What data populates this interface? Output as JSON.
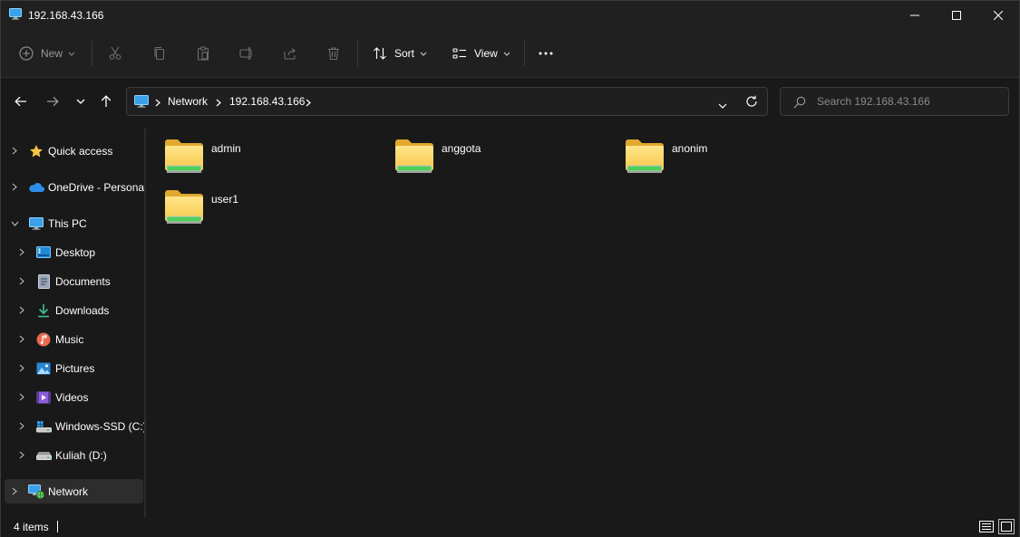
{
  "window": {
    "title": "192.168.43.166",
    "accent": "#60cdff"
  },
  "commandbar": {
    "new_label": "New",
    "sort_label": "Sort",
    "view_label": "View",
    "items": [
      {
        "name": "new-button",
        "icon": "plus-circle-icon"
      },
      {
        "name": "cut-button",
        "icon": "scissors-icon"
      },
      {
        "name": "copy-button",
        "icon": "copy-icon"
      },
      {
        "name": "paste-button",
        "icon": "paste-icon"
      },
      {
        "name": "rename-button",
        "icon": "rename-icon"
      },
      {
        "name": "share-button",
        "icon": "share-icon"
      },
      {
        "name": "delete-button",
        "icon": "trash-icon"
      },
      {
        "name": "sort-button",
        "icon": "sort-icon"
      },
      {
        "name": "view-button",
        "icon": "view-list-icon"
      },
      {
        "name": "more-button",
        "icon": "ellipsis-icon"
      }
    ]
  },
  "address": {
    "crumbs": [
      "Network",
      "192.168.43.166"
    ],
    "search_placeholder": "Search 192.168.43.166"
  },
  "sidebar": {
    "items": [
      {
        "label": "Quick access",
        "icon": "star-icon"
      },
      {
        "label": "OneDrive - Personal",
        "icon": "cloud-icon"
      },
      {
        "label": "This PC",
        "icon": "monitor-icon"
      },
      {
        "label": "Desktop",
        "icon": "desktop-icon"
      },
      {
        "label": "Documents",
        "icon": "document-icon"
      },
      {
        "label": "Downloads",
        "icon": "download-icon"
      },
      {
        "label": "Music",
        "icon": "music-icon"
      },
      {
        "label": "Pictures",
        "icon": "pictures-icon"
      },
      {
        "label": "Videos",
        "icon": "videos-icon"
      },
      {
        "label": "Windows-SSD (C:)",
        "icon": "drive-c-icon"
      },
      {
        "label": "Kuliah (D:)",
        "icon": "drive-icon"
      },
      {
        "label": "Network",
        "icon": "network-icon",
        "selected": true
      }
    ]
  },
  "folders": [
    {
      "name": "admin"
    },
    {
      "name": "anggota"
    },
    {
      "name": "anonim"
    },
    {
      "name": "user1"
    }
  ],
  "status": {
    "item_count": "4 items"
  }
}
